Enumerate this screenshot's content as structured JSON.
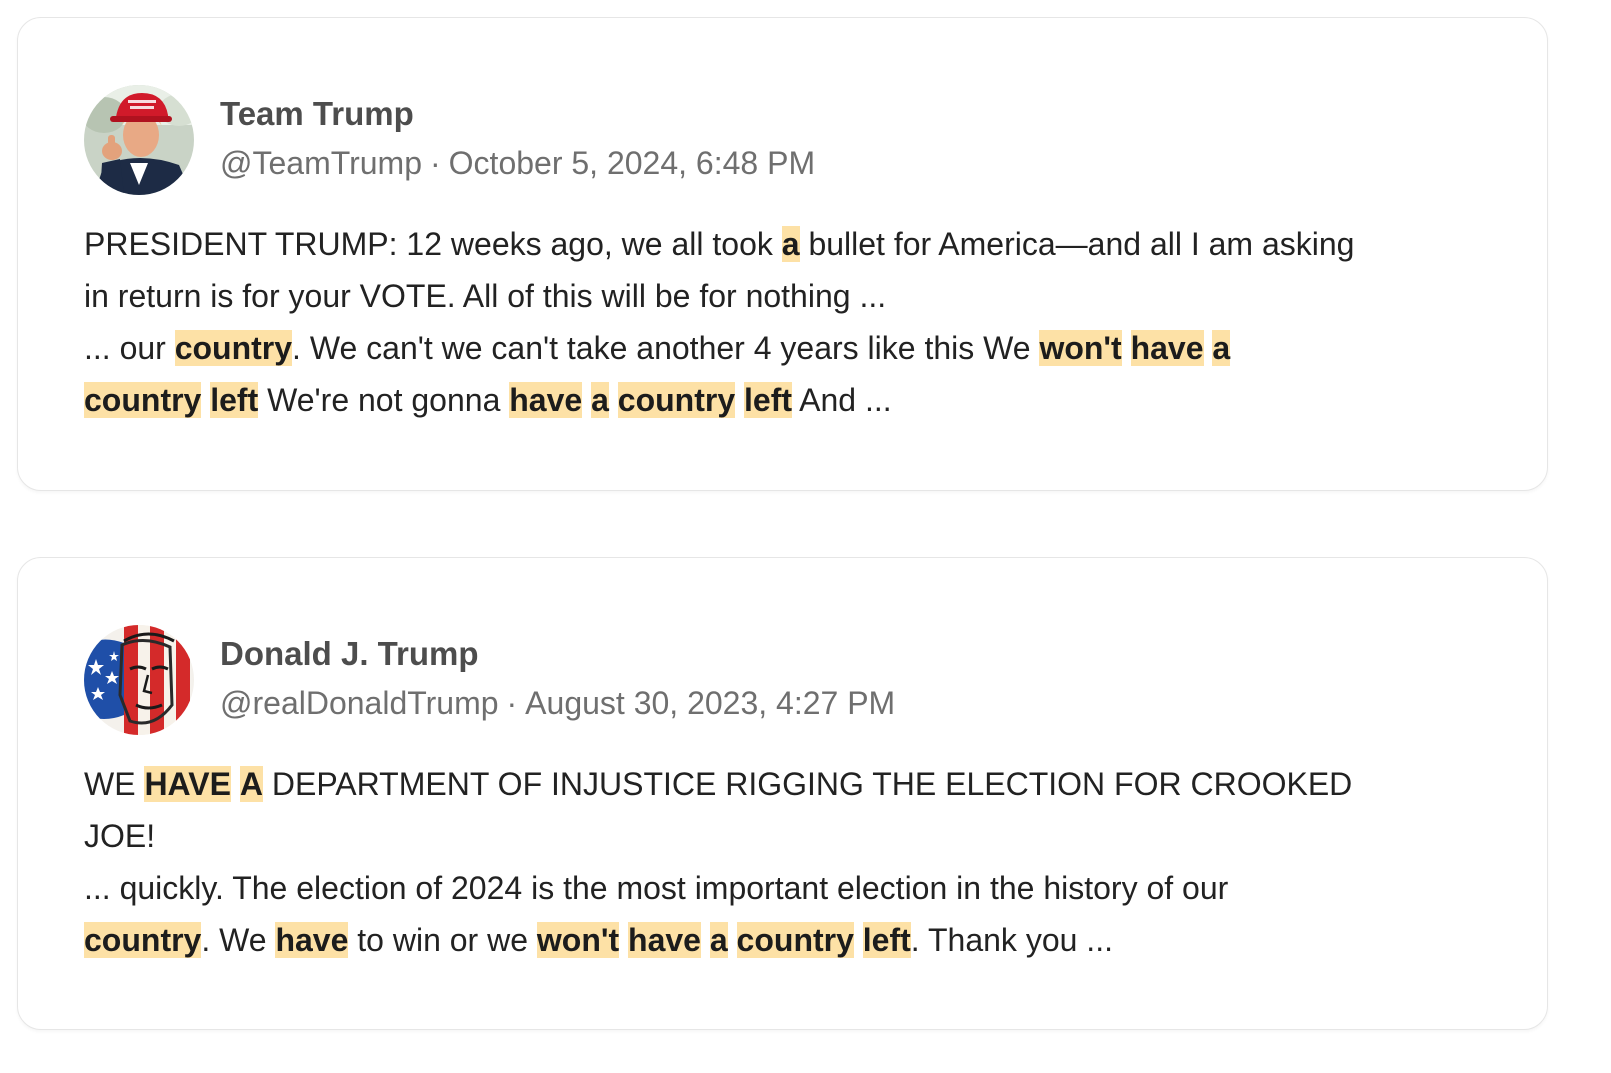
{
  "posts": [
    {
      "display_name": "Team Trump",
      "handle": "@TeamTrump",
      "separator": "·",
      "timestamp": "October 5, 2024, 6:48 PM",
      "avatar_icon": "portrait-red-cap-thumbs-up",
      "lines": [
        [
          {
            "text": "PRESIDENT TRUMP: 12 weeks ago, we all took ",
            "hl": false
          },
          {
            "text": "a",
            "hl": true
          },
          {
            "text": " bullet for America—and all I am asking",
            "hl": false
          }
        ],
        [
          {
            "text": "in return is for your VOTE. All of this will be for nothing ...",
            "hl": false
          }
        ],
        [
          {
            "text": "... our ",
            "hl": false
          },
          {
            "text": "country",
            "hl": true
          },
          {
            "text": ". We can't we can't take another 4 years like this We ",
            "hl": false
          },
          {
            "text": "won't",
            "hl": true
          },
          {
            "text": " ",
            "hl": false
          },
          {
            "text": "have",
            "hl": true
          },
          {
            "text": " ",
            "hl": false
          },
          {
            "text": "a",
            "hl": true
          }
        ],
        [
          {
            "text": "country",
            "hl": true
          },
          {
            "text": " ",
            "hl": false
          },
          {
            "text": "left",
            "hl": true
          },
          {
            "text": " We're not gonna ",
            "hl": false
          },
          {
            "text": "have",
            "hl": true
          },
          {
            "text": " ",
            "hl": false
          },
          {
            "text": "a",
            "hl": true
          },
          {
            "text": " ",
            "hl": false
          },
          {
            "text": "country",
            "hl": true
          },
          {
            "text": " ",
            "hl": false
          },
          {
            "text": "left",
            "hl": true
          },
          {
            "text": " And ...",
            "hl": false
          }
        ]
      ]
    },
    {
      "display_name": "Donald J. Trump",
      "handle": "@realDonaldTrump",
      "separator": "·",
      "timestamp": "August 30, 2023, 4:27 PM",
      "avatar_icon": "portrait-american-flag-painted-face",
      "lines": [
        [
          {
            "text": "WE ",
            "hl": false
          },
          {
            "text": "HAVE",
            "hl": true
          },
          {
            "text": " ",
            "hl": false
          },
          {
            "text": "A",
            "hl": true
          },
          {
            "text": " DEPARTMENT OF INJUSTICE RIGGING THE ELECTION FOR CROOKED",
            "hl": false
          }
        ],
        [
          {
            "text": "JOE!",
            "hl": false
          }
        ],
        [
          {
            "text": "... quickly. The election of 2024 is the most important election in the history of our",
            "hl": false
          }
        ],
        [
          {
            "text": "country",
            "hl": true
          },
          {
            "text": ". We ",
            "hl": false
          },
          {
            "text": "have",
            "hl": true
          },
          {
            "text": " to win or we ",
            "hl": false
          },
          {
            "text": "won't",
            "hl": true
          },
          {
            "text": " ",
            "hl": false
          },
          {
            "text": "have",
            "hl": true
          },
          {
            "text": " ",
            "hl": false
          },
          {
            "text": "a",
            "hl": true
          },
          {
            "text": " ",
            "hl": false
          },
          {
            "text": "country",
            "hl": true
          },
          {
            "text": " ",
            "hl": false
          },
          {
            "text": "left",
            "hl": true
          },
          {
            "text": ". Thank you ...",
            "hl": false
          }
        ]
      ]
    }
  ],
  "colors": {
    "highlight_bg": "#fde1a6",
    "name": "#4d4d4d",
    "meta": "#6f6f6f",
    "body": "#222222",
    "card_border": "#e6e6e6"
  }
}
